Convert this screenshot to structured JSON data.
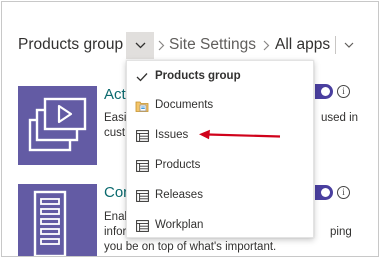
{
  "breadcrumb": {
    "current": "Products group",
    "site_settings": "Site Settings",
    "all_apps": "All apps"
  },
  "cards": [
    {
      "title": "Act",
      "desc_line1": "Easi",
      "desc_line1_tail": "used in",
      "desc_line2": "cust"
    },
    {
      "title": "Con",
      "desc_line1": "Enab",
      "desc_line2": "infor",
      "desc_line2_tail": "ping",
      "desc_line3": "you be on top of what's important."
    }
  ],
  "menu": {
    "items": [
      {
        "label": "Products group",
        "icon": "check-icon",
        "selected": true
      },
      {
        "label": "Documents",
        "icon": "document-library-icon",
        "selected": false
      },
      {
        "label": "Issues",
        "icon": "list-icon",
        "selected": false
      },
      {
        "label": "Products",
        "icon": "list-icon",
        "selected": false
      },
      {
        "label": "Releases",
        "icon": "list-icon",
        "selected": false
      },
      {
        "label": "Workplan",
        "icon": "list-icon",
        "selected": false
      }
    ]
  },
  "info_glyph": "i",
  "colors": {
    "thumb": "#635ba4",
    "accent_title": "#0b6a6e",
    "toggle": "#4a3f9f",
    "arrow": "#d0021b"
  }
}
